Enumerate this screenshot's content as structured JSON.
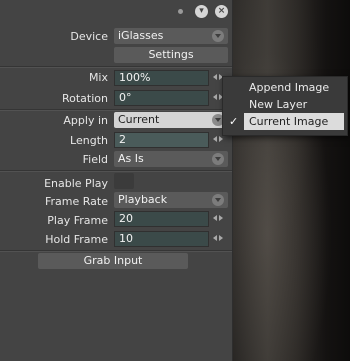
{
  "titlebar": {
    "icons": [
      "dot-icon",
      "menu-icon",
      "close-icon"
    ]
  },
  "device": {
    "label": "Device",
    "value": "iGlasses"
  },
  "settings_button": "Settings",
  "mix": {
    "label": "Mix",
    "value": "100%"
  },
  "rotation": {
    "label": "Rotation",
    "value": "0°"
  },
  "apply_in": {
    "label": "Apply in",
    "value": "Current",
    "options": [
      "Append Image",
      "New Layer",
      "Current Image"
    ],
    "selected": "Current Image"
  },
  "length": {
    "label": "Length",
    "value": "2"
  },
  "field": {
    "label": "Field",
    "value": "As Is"
  },
  "enable_play": {
    "label": "Enable Play"
  },
  "frame_rate": {
    "label": "Frame Rate",
    "value": "Playback"
  },
  "play_frame": {
    "label": "Play Frame",
    "value": "20"
  },
  "hold_frame": {
    "label": "Hold Frame",
    "value": "10"
  },
  "grab_button": "Grab Input",
  "colors": {
    "panel": "#444444",
    "field": "#3b4a49",
    "dropdown": "#5a5a5a",
    "selection": "#dcdcdc"
  }
}
